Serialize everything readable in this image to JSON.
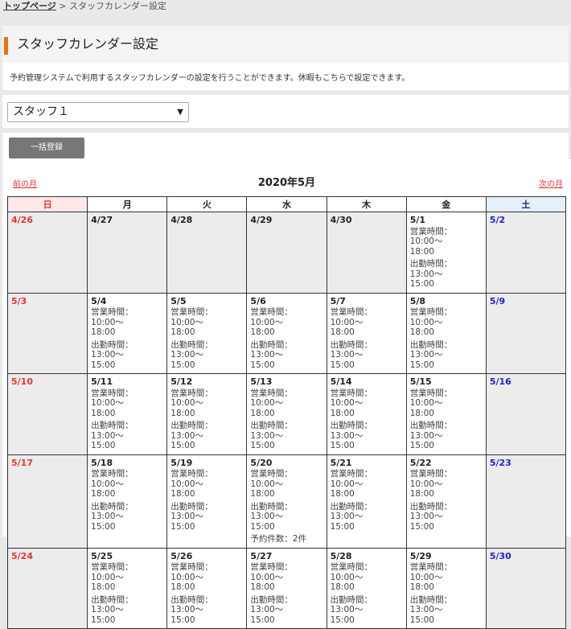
{
  "breadcrumb": {
    "home": "トップページ",
    "sep": ">",
    "current": "スタッフカレンダー設定"
  },
  "page_title": "スタッフカレンダー設定",
  "description": "予約管理システムで利用するスタッフカレンダーの設定を行うことができます。休暇もこちらで設定できます。",
  "staff_select": {
    "value": "スタッフ１"
  },
  "bulk_button": "一括登録",
  "calendar": {
    "prev": "前の月",
    "next": "次の月",
    "month": "2020年5月",
    "weekdays": [
      "日",
      "月",
      "火",
      "水",
      "木",
      "金",
      "土"
    ],
    "hours1": "営業時間：10:00〜",
    "hours1b": "18:00",
    "hours2": "出勤時間：13:00〜",
    "hours2b": "15:00",
    "reservations": "予約件数：2件",
    "weeks": [
      [
        "4/26",
        "4/27",
        "4/28",
        "4/29",
        "4/30",
        "5/1",
        "5/2"
      ],
      [
        "5/3",
        "5/4",
        "5/5",
        "5/6",
        "5/7",
        "5/8",
        "5/9"
      ],
      [
        "5/10",
        "5/11",
        "5/12",
        "5/13",
        "5/14",
        "5/15",
        "5/16"
      ],
      [
        "5/17",
        "5/18",
        "5/19",
        "5/20",
        "5/21",
        "5/22",
        "5/23"
      ],
      [
        "5/24",
        "5/25",
        "5/26",
        "5/27",
        "5/28",
        "5/29",
        "5/30"
      ]
    ]
  }
}
